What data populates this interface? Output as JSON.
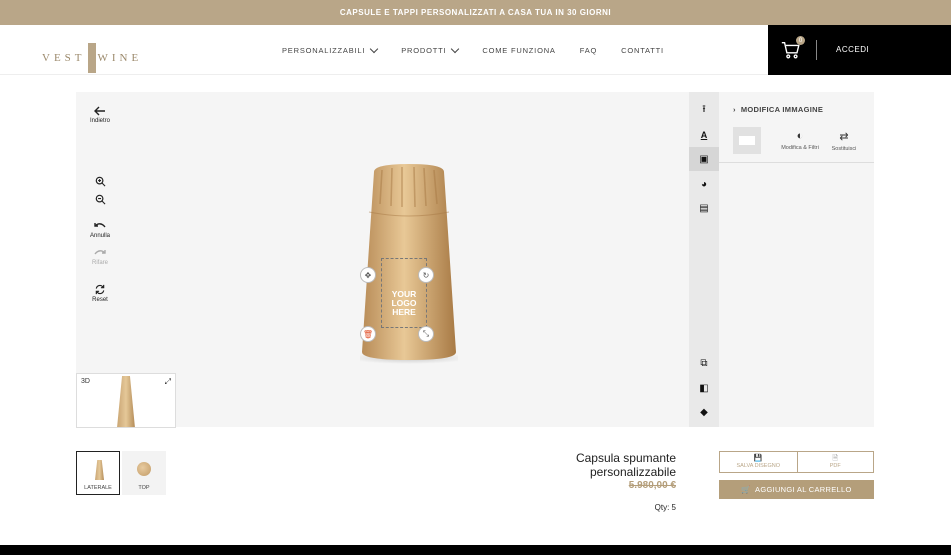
{
  "promo": "CAPSULE E TAPPI PERSONALIZZATI A CASA TUA IN 30 GIORNI",
  "brand": {
    "left": "VEST",
    "right": "WINE"
  },
  "nav": [
    "PERSONALIZZABILI",
    "PRODOTTI",
    "COME FUNZIONA",
    "FAQ",
    "CONTATTI"
  ],
  "header": {
    "cart_count": "0",
    "login": "ACCEDI"
  },
  "tools": {
    "back": "Indietro",
    "undo": "Annulla",
    "redo": "Rifare",
    "reset": "Reset"
  },
  "minimap": {
    "label": "3D"
  },
  "design": {
    "logo_text": "YOUR LOGO HERE"
  },
  "panel": {
    "title": "MODIFICA IMMAGINE",
    "edit_filters": "Modifica & Filtri",
    "replace": "Sostituisci"
  },
  "views": [
    "LATERALE",
    "TOP"
  ],
  "product": {
    "name": "Capsula spumante personalizzabile",
    "price": "5.980,00 €",
    "qty": "Qty: 5"
  },
  "actions": {
    "save": "SALVA DISEGNO",
    "pdf": "PDF",
    "add_to_cart": "AGGIUNGI AL CARRELLO"
  },
  "colors": {
    "accent": "#b9a688",
    "dark": "#000000"
  }
}
